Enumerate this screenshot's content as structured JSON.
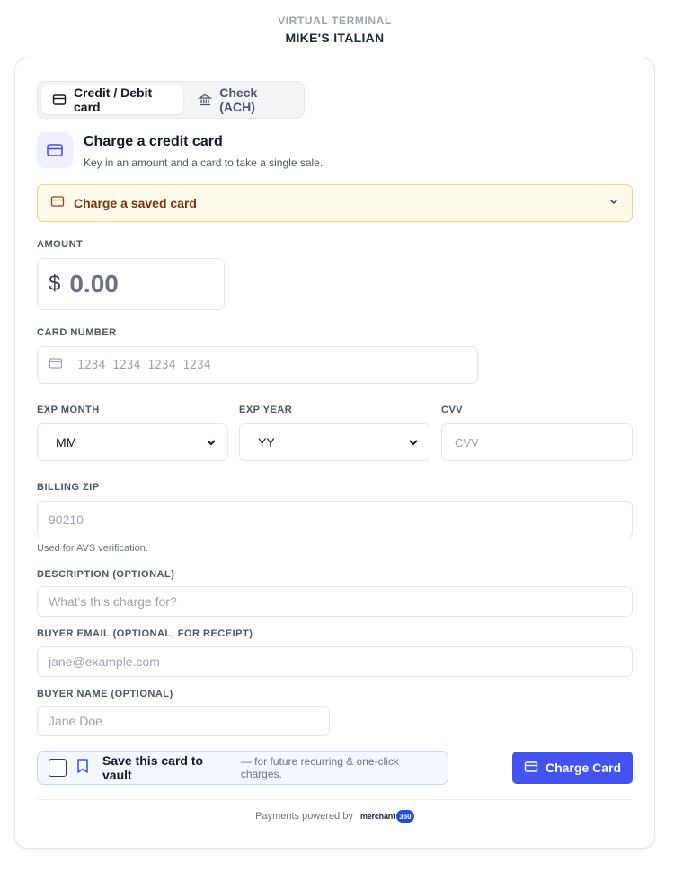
{
  "header": {
    "eyebrow": "VIRTUAL TERMINAL",
    "merchant_name": "MIKE'S ITALIAN"
  },
  "tabs": [
    {
      "label": "Credit / Debit card",
      "icon": "credit-card-icon",
      "active": true
    },
    {
      "label": "Check (ACH)",
      "icon": "bank-icon",
      "active": false
    }
  ],
  "hero": {
    "title": "Charge a credit card",
    "subtitle": "Key in an amount and a card to take a single sale."
  },
  "saved_card": {
    "label": "Charge a saved card"
  },
  "form": {
    "amount": {
      "label": "AMOUNT",
      "currency_symbol": "$",
      "placeholder": "0.00"
    },
    "card_number": {
      "label": "CARD NUMBER",
      "placeholder": "1234 1234 1234 1234"
    },
    "exp_month": {
      "label": "EXP MONTH",
      "selected": "MM"
    },
    "exp_year": {
      "label": "EXP YEAR",
      "selected": "YY"
    },
    "cvv": {
      "label": "CVV",
      "placeholder": "CVV"
    },
    "billing_zip": {
      "label": "BILLING ZIP",
      "placeholder": "90210",
      "helper": "Used for AVS verification."
    },
    "description": {
      "label": "DESCRIPTION (OPTIONAL)",
      "placeholder": "What's this charge for?"
    },
    "buyer_email": {
      "label": "BUYER EMAIL (OPTIONAL, FOR RECEIPT)",
      "placeholder": "jane@example.com"
    },
    "buyer_name": {
      "label": "BUYER NAME (OPTIONAL)",
      "placeholder": "Jane Doe"
    }
  },
  "vault": {
    "label": "Save this card to vault",
    "note": "— for future recurring & one-click charges."
  },
  "charge_button": {
    "label": "Charge Card"
  },
  "footer": {
    "text": "Payments powered by",
    "logo_word": "merchant",
    "logo_badge": "360"
  },
  "colors": {
    "accent": "#4352f0",
    "saved_bg": "#fffbeb",
    "saved_border": "#f2d674",
    "saved_text": "#78350f"
  }
}
